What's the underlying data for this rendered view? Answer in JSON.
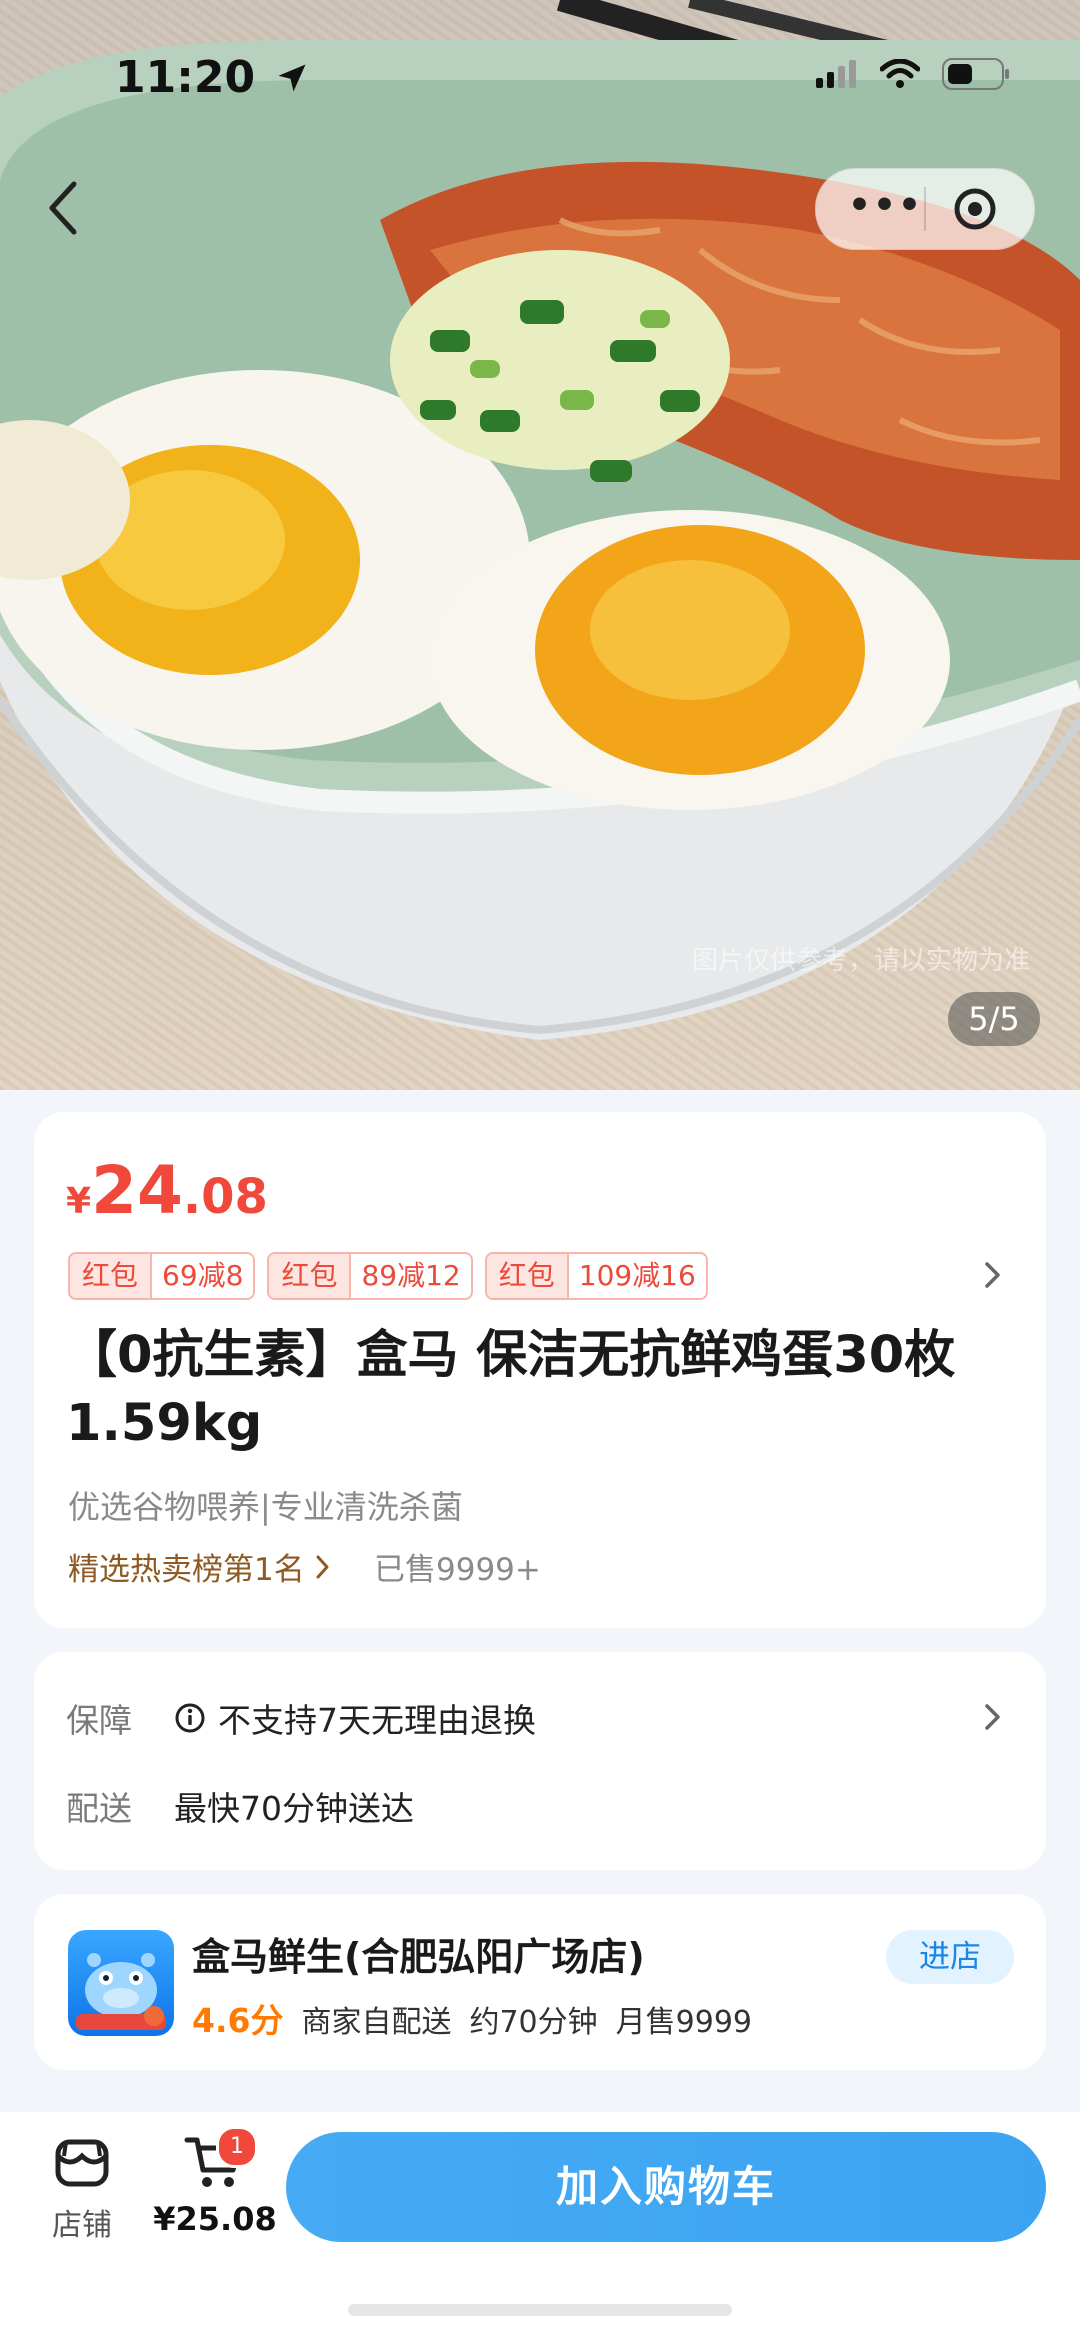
{
  "status_bar": {
    "time": "11:20"
  },
  "gallery": {
    "caption": "图片仅供参考，请以实物为准",
    "counter": "5/5"
  },
  "product": {
    "price_currency": "¥",
    "price_integer": "24",
    "price_decimal": ".08",
    "coupons": [
      {
        "tag": "红包",
        "amount": "69减8"
      },
      {
        "tag": "红包",
        "amount": "89减12"
      },
      {
        "tag": "红包",
        "amount": "109减16"
      }
    ],
    "title": "【0抗生素】盒马 保洁无抗鲜鸡蛋30枚1.59kg",
    "subtitle": "优选谷物喂养|专业清洗杀菌",
    "rank": "精选热卖榜第1名",
    "sold": "已售9999+"
  },
  "service": {
    "guarantee_label": "保障",
    "guarantee_value": "不支持7天无理由退换",
    "delivery_label": "配送",
    "delivery_value": "最快70分钟送达"
  },
  "store": {
    "name": "盒马鲜生(合肥弘阳广场店)",
    "score": "4.6分",
    "delivery_mode": "商家自配送",
    "eta": "约70分钟",
    "monthly_sales": "月售9999",
    "enter_label": "进店"
  },
  "bottom_bar": {
    "shop_label": "店铺",
    "cart_total": "¥25.08",
    "cart_badge": "1",
    "add_to_cart": "加入购物车"
  },
  "colors": {
    "accent_blue": "#3ba3f2",
    "price_red": "#f0493c",
    "rank_brown": "#8c5a22"
  }
}
